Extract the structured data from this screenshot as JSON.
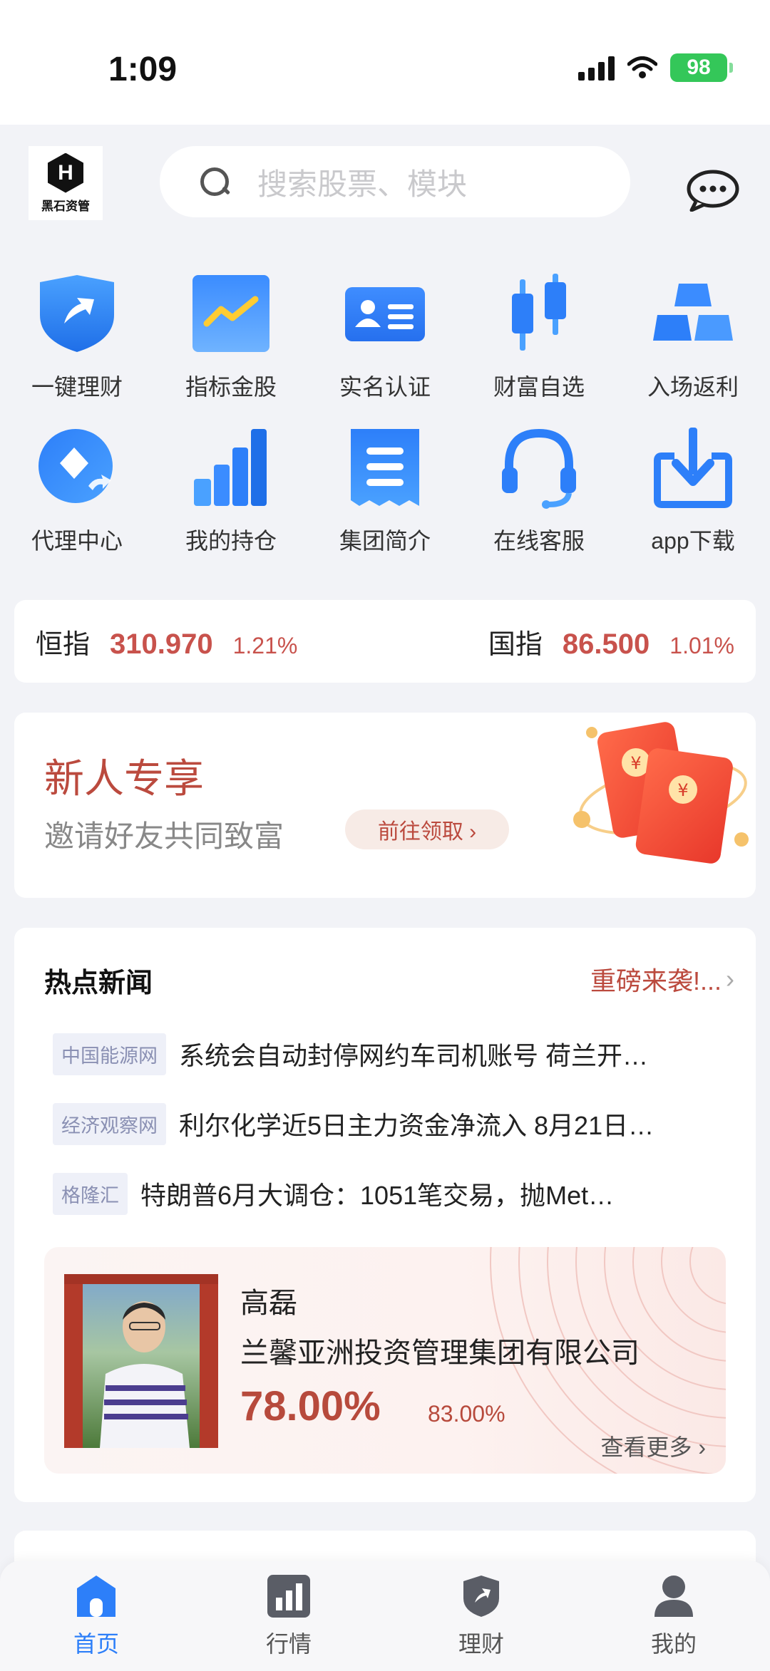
{
  "status_bar": {
    "time": "1:09",
    "battery": "98"
  },
  "header": {
    "logo_text": "黑石资管",
    "logo_letter": "H",
    "search_placeholder": "搜索股票、模块"
  },
  "grid": [
    {
      "label": "一键理财",
      "icon": "shield-arrow-icon"
    },
    {
      "label": "指标金股",
      "icon": "trend-chart-icon"
    },
    {
      "label": "实名认证",
      "icon": "id-card-icon"
    },
    {
      "label": "财富自选",
      "icon": "candlestick-icon"
    },
    {
      "label": "入场返利",
      "icon": "gold-bars-icon"
    },
    {
      "label": "代理中心",
      "icon": "diamond-icon"
    },
    {
      "label": "我的持仓",
      "icon": "bar-chart-icon"
    },
    {
      "label": "集团简介",
      "icon": "document-icon"
    },
    {
      "label": "在线客服",
      "icon": "headset-icon"
    },
    {
      "label": "app下载",
      "icon": "download-icon"
    }
  ],
  "indices": [
    {
      "name": "恒指",
      "value": "310.970",
      "pct": "1.21%"
    },
    {
      "name": "国指",
      "value": "86.500",
      "pct": "1.01%"
    }
  ],
  "promo": {
    "title": "新人专享",
    "subtitle": "邀请好友共同致富",
    "button": "前往领取 ›"
  },
  "news": {
    "header": "热点新闻",
    "more": "重磅来袭!...",
    "items": [
      {
        "source": "中国能源网",
        "title": "系统会自动封停网约车司机账号 荷兰开…"
      },
      {
        "source": "经济观察网",
        "title": "利尔化学近5日主力资金净流入 8月21日…"
      },
      {
        "source": "格隆汇",
        "title": "特朗普6月大调仓：1051笔交易，抛Met…"
      }
    ]
  },
  "manager": {
    "name": "高磊",
    "company": "兰馨亚洲投资管理集团有限公司",
    "rate": "78.00%",
    "rate2": "83.00%",
    "more": "查看更多 ›"
  },
  "tabs": [
    {
      "label": "首页",
      "icon": "home-icon",
      "active": true
    },
    {
      "label": "行情",
      "icon": "market-icon",
      "active": false
    },
    {
      "label": "理财",
      "icon": "finance-icon",
      "active": false
    },
    {
      "label": "我的",
      "icon": "profile-icon",
      "active": false
    }
  ],
  "colors": {
    "accent_blue": "#2d7ff9",
    "red": "#c8524c",
    "brand_red": "#bb4a3e"
  }
}
